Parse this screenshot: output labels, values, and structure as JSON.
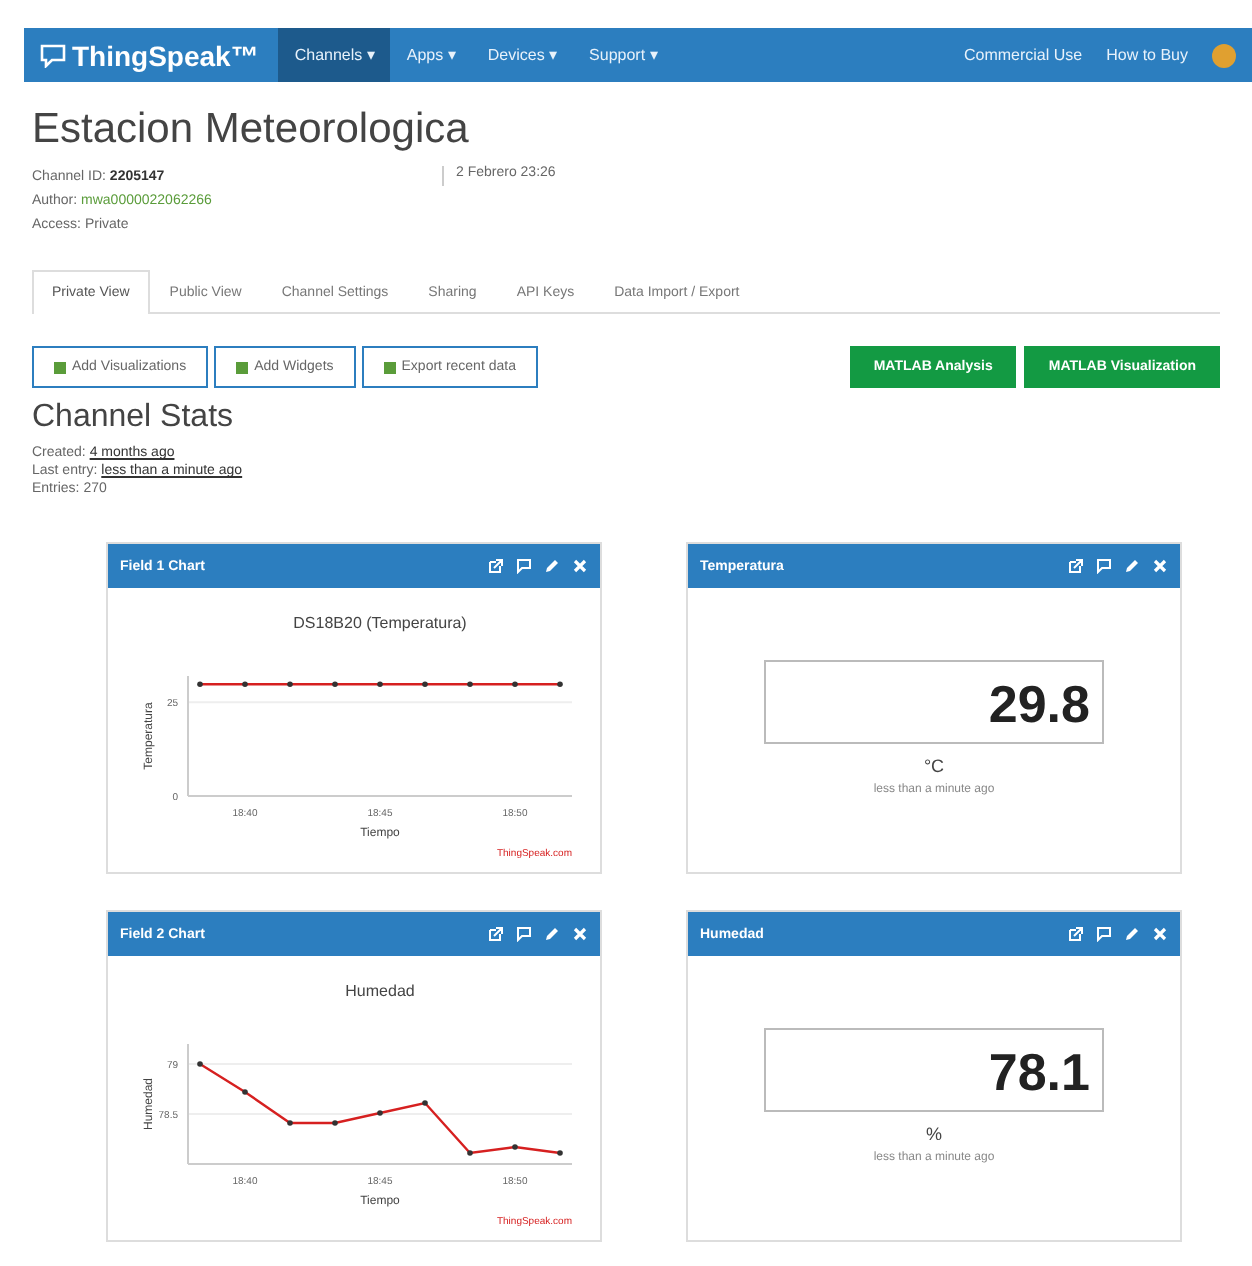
{
  "navbar": {
    "brand": "ThingSpeak™",
    "menus": [
      {
        "label": "Channels ▾",
        "selected": true
      },
      {
        "label": "Apps ▾",
        "selected": false
      },
      {
        "label": "Devices ▾",
        "selected": false
      },
      {
        "label": "Support ▾",
        "selected": false
      }
    ],
    "right_links": [
      "Commercial Use",
      "How to Buy"
    ]
  },
  "channel": {
    "title": "Estacion Meteorologica",
    "meta": [
      {
        "label": "Channel ID:",
        "value": "2205147",
        "kind": "bold"
      },
      {
        "label": "Author:",
        "value": "mwa0000022062266",
        "kind": "link"
      },
      {
        "label": "Access:",
        "value": "Private",
        "kind": "plain"
      }
    ],
    "date": "2 Febrero 23:26"
  },
  "tabs": [
    {
      "label": "Private View",
      "selected": true
    },
    {
      "label": "Public View",
      "selected": false
    },
    {
      "label": "Channel Settings",
      "selected": false
    },
    {
      "label": "Sharing",
      "selected": false
    },
    {
      "label": "API Keys",
      "selected": false
    },
    {
      "label": "Data Import / Export",
      "selected": false
    }
  ],
  "actions": [
    "Add Visualizations",
    "Add Widgets",
    "Export recent data"
  ],
  "matlab_buttons": [
    "MATLAB Analysis",
    "MATLAB Visualization"
  ],
  "stats": {
    "title": "Channel Stats",
    "rows": [
      {
        "label": "Created:",
        "value": "4 months ago",
        "kind": "link"
      },
      {
        "label": "Last entry:",
        "value": "less than a minute ago",
        "kind": "link"
      },
      {
        "label": "Entries:",
        "value": "270",
        "kind": "plain"
      }
    ]
  },
  "widgets": [
    {
      "kind": "chart",
      "title": "Field 1 Chart",
      "footer": "ThingSpeak.com",
      "chart_data": {
        "type": "line",
        "title": "DS18B20 (Temperatura)",
        "xlabel": "Tiempo",
        "ylabel": "Temperatura",
        "categories": [
          null,
          "18:40",
          null,
          null,
          "18:45",
          null,
          null,
          "18:50",
          null
        ],
        "series": [
          {
            "color": "#d62020",
            "values": [
              29.8,
              29.8,
              29.8,
              29.8,
              29.8,
              29.8,
              29.8,
              29.8,
              29.8
            ]
          }
        ],
        "ylim": [
          0,
          32
        ],
        "yticks": [
          0,
          25
        ]
      }
    },
    {
      "kind": "numeric",
      "title": "Temperatura",
      "value": "29.8",
      "unit": "°C",
      "updated": "less than a minute ago"
    },
    {
      "kind": "chart",
      "title": "Field 2 Chart",
      "footer": "ThingSpeak.com",
      "chart_data": {
        "type": "line",
        "title": "Humedad",
        "xlabel": "Tiempo",
        "ylabel": "Humedad",
        "categories": [
          null,
          "18:40",
          null,
          null,
          "18:45",
          null,
          null,
          "18:50",
          null
        ],
        "series": [
          {
            "color": "#d62020",
            "values": [
              79,
              78.72,
              78.41,
              78.41,
              78.51,
              78.61,
              78.11,
              78.17,
              78.11
            ]
          }
        ],
        "ylim": [
          78,
          79.2
        ],
        "yticks": [
          78.5,
          79
        ]
      }
    },
    {
      "kind": "numeric",
      "title": "Humedad",
      "value": "78.1",
      "unit": "%",
      "updated": "less than a minute ago"
    }
  ]
}
